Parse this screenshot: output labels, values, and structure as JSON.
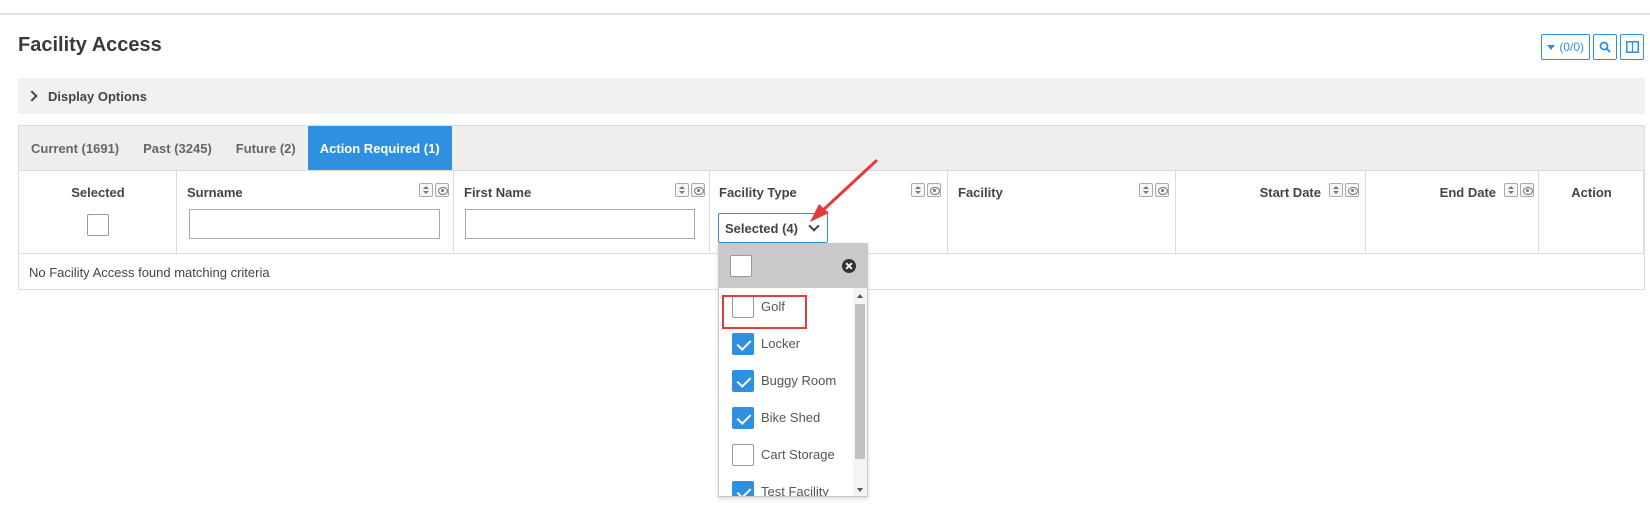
{
  "page": {
    "title": "Facility Access"
  },
  "toolbar": {
    "filter_count": "(0/0)",
    "icons": [
      "filter-dropdown-icon",
      "search-icon",
      "columns-icon"
    ]
  },
  "display_options": {
    "label": "Display Options"
  },
  "tabs": [
    {
      "label": "Current (1691)",
      "active": false
    },
    {
      "label": "Past (3245)",
      "active": false
    },
    {
      "label": "Future (2)",
      "active": false
    },
    {
      "label": "Action Required (1)",
      "active": true
    }
  ],
  "grid": {
    "columns": [
      {
        "label": "Selected"
      },
      {
        "label": "Surname"
      },
      {
        "label": "First Name"
      },
      {
        "label": "Facility Type"
      },
      {
        "label": "Facility"
      },
      {
        "label": "Start Date"
      },
      {
        "label": "End Date"
      },
      {
        "label": "Action"
      }
    ],
    "empty_message": "No Facility Access found matching criteria"
  },
  "facility_type_filter": {
    "button_label": "Selected (4)",
    "options": [
      {
        "label": "Golf",
        "checked": false
      },
      {
        "label": "Locker",
        "checked": true
      },
      {
        "label": "Buggy Room",
        "checked": true
      },
      {
        "label": "Bike Shed",
        "checked": true
      },
      {
        "label": "Cart Storage",
        "checked": false
      },
      {
        "label": "Test Facility",
        "checked": true
      }
    ]
  },
  "colors": {
    "accent": "#2f8fe0",
    "annotation": "#e23b3b"
  }
}
